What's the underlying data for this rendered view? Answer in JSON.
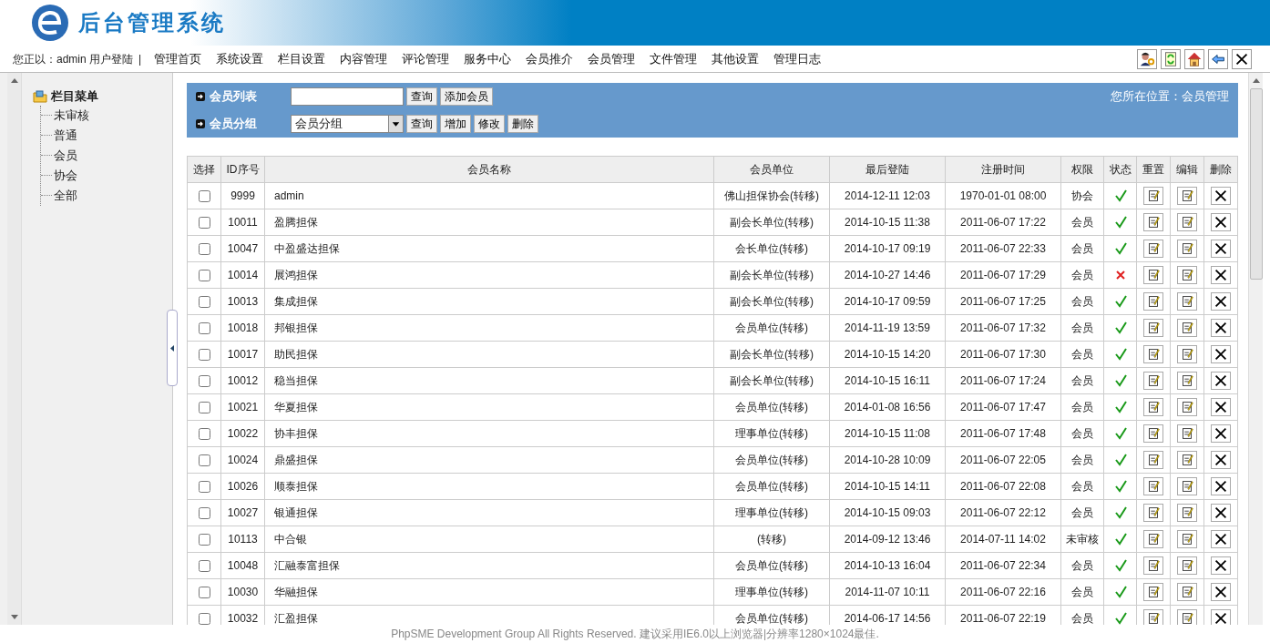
{
  "header": {
    "title": "后台管理系统"
  },
  "topbar": {
    "user_text": "您正以：admin 用户登陆",
    "separator": "|",
    "nav": [
      {
        "label": "管理首页"
      },
      {
        "label": "系统设置"
      },
      {
        "label": "栏目设置"
      },
      {
        "label": "内容管理"
      },
      {
        "label": "评论管理"
      },
      {
        "label": "服务中心"
      },
      {
        "label": "会员推介"
      },
      {
        "label": "会员管理"
      },
      {
        "label": "文件管理"
      },
      {
        "label": "其他设置"
      },
      {
        "label": "管理日志"
      }
    ],
    "tools": [
      {
        "kind": "user"
      },
      {
        "kind": "refresh"
      },
      {
        "kind": "home"
      },
      {
        "kind": "back"
      },
      {
        "kind": "close"
      }
    ]
  },
  "sidebar": {
    "title": "栏目菜单",
    "items": [
      {
        "label": "未审核"
      },
      {
        "label": "普通"
      },
      {
        "label": "会员"
      },
      {
        "label": "协会"
      },
      {
        "label": "全部"
      }
    ]
  },
  "toolbar": {
    "list_label": "会员列表",
    "search_button": "查询",
    "add_button": "添加会员",
    "group_label": "会员分组",
    "group_select": "会员分组",
    "group_buttons": [
      "查询",
      "增加",
      "修改",
      "删除"
    ],
    "location": "您所在位置：会员管理"
  },
  "table": {
    "columns": [
      "选择",
      "ID序号",
      "会员名称",
      "会员单位",
      "最后登陆",
      "注册时间",
      "权限",
      "状态",
      "重置",
      "编辑",
      "删除"
    ],
    "rows": [
      {
        "checked": false,
        "id": "9999",
        "name": "admin",
        "unit": "佛山担保协会(转移)",
        "last_login": "2014-12-11 12:03",
        "registered": "1970-01-01 08:00",
        "role": "协会",
        "active": true
      },
      {
        "checked": false,
        "id": "10011",
        "name": "盈腾担保",
        "unit": "副会长单位(转移)",
        "last_login": "2014-10-15 11:38",
        "registered": "2011-06-07 17:22",
        "role": "会员",
        "active": true
      },
      {
        "checked": false,
        "id": "10047",
        "name": "中盈盛达担保",
        "unit": "会长单位(转移)",
        "last_login": "2014-10-17 09:19",
        "registered": "2011-06-07 22:33",
        "role": "会员",
        "active": true
      },
      {
        "checked": false,
        "id": "10014",
        "name": "展鸿担保",
        "unit": "副会长单位(转移)",
        "last_login": "2014-10-27 14:46",
        "registered": "2011-06-07 17:29",
        "role": "会员",
        "active": false
      },
      {
        "checked": false,
        "id": "10013",
        "name": "集成担保",
        "unit": "副会长单位(转移)",
        "last_login": "2014-10-17 09:59",
        "registered": "2011-06-07 17:25",
        "role": "会员",
        "active": true
      },
      {
        "checked": false,
        "id": "10018",
        "name": "邦银担保",
        "unit": "会员单位(转移)",
        "last_login": "2014-11-19 13:59",
        "registered": "2011-06-07 17:32",
        "role": "会员",
        "active": true
      },
      {
        "checked": false,
        "id": "10017",
        "name": "助民担保",
        "unit": "副会长单位(转移)",
        "last_login": "2014-10-15 14:20",
        "registered": "2011-06-07 17:30",
        "role": "会员",
        "active": true
      },
      {
        "checked": false,
        "id": "10012",
        "name": "稳当担保",
        "unit": "副会长单位(转移)",
        "last_login": "2014-10-15 16:11",
        "registered": "2011-06-07 17:24",
        "role": "会员",
        "active": true
      },
      {
        "checked": false,
        "id": "10021",
        "name": "华夏担保",
        "unit": "会员单位(转移)",
        "last_login": "2014-01-08 16:56",
        "registered": "2011-06-07 17:47",
        "role": "会员",
        "active": true
      },
      {
        "checked": false,
        "id": "10022",
        "name": "协丰担保",
        "unit": "理事单位(转移)",
        "last_login": "2014-10-15 11:08",
        "registered": "2011-06-07 17:48",
        "role": "会员",
        "active": true
      },
      {
        "checked": false,
        "id": "10024",
        "name": "鼎盛担保",
        "unit": "会员单位(转移)",
        "last_login": "2014-10-28 10:09",
        "registered": "2011-06-07 22:05",
        "role": "会员",
        "active": true
      },
      {
        "checked": false,
        "id": "10026",
        "name": "顺泰担保",
        "unit": "会员单位(转移)",
        "last_login": "2014-10-15 14:11",
        "registered": "2011-06-07 22:08",
        "role": "会员",
        "active": true
      },
      {
        "checked": false,
        "id": "10027",
        "name": "银通担保",
        "unit": "理事单位(转移)",
        "last_login": "2014-10-15 09:03",
        "registered": "2011-06-07 22:12",
        "role": "会员",
        "active": true
      },
      {
        "checked": false,
        "id": "10113",
        "name": "中合银",
        "unit": "(转移)",
        "last_login": "2014-09-12 13:46",
        "registered": "2014-07-11 14:02",
        "role": "未审核",
        "active": true
      },
      {
        "checked": false,
        "id": "10048",
        "name": "汇融泰富担保",
        "unit": "会员单位(转移)",
        "last_login": "2014-10-13 16:04",
        "registered": "2011-06-07 22:34",
        "role": "会员",
        "active": true
      },
      {
        "checked": false,
        "id": "10030",
        "name": "华融担保",
        "unit": "理事单位(转移)",
        "last_login": "2014-11-07 10:11",
        "registered": "2011-06-07 22:16",
        "role": "会员",
        "active": true
      },
      {
        "checked": false,
        "id": "10032",
        "name": "汇盈担保",
        "unit": "会员单位(转移)",
        "last_login": "2014-06-17 14:56",
        "registered": "2011-06-07 22:19",
        "role": "会员",
        "active": true
      }
    ]
  },
  "footer": "PhpSME Development Group All Rights Reserved. 建议采用IE6.0以上浏览器|分辨率1280×1024最佳."
}
